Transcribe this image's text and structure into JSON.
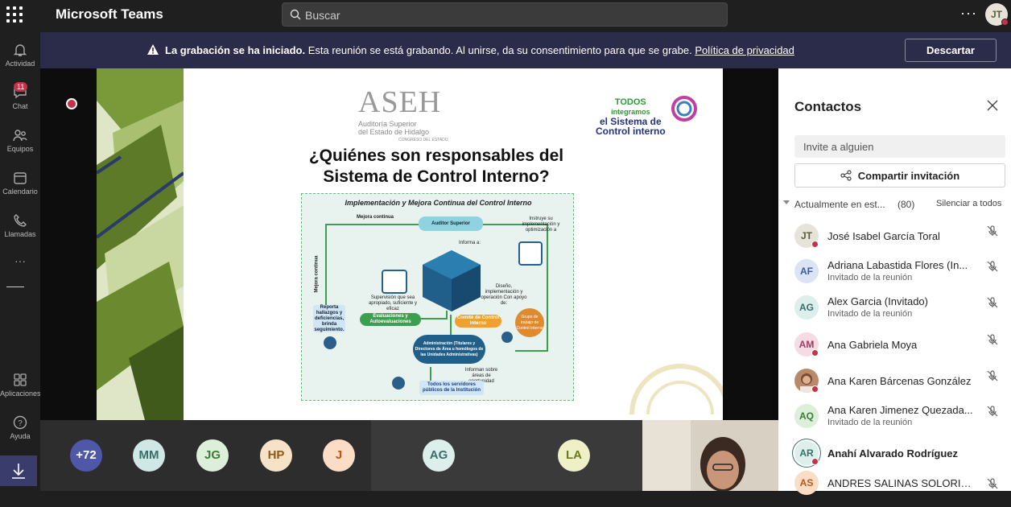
{
  "app": {
    "title": "Microsoft Teams",
    "search_placeholder": "Buscar",
    "more": "···",
    "me_initials": "JT"
  },
  "rail": [
    {
      "label": "Actividad",
      "icon": "bell-icon"
    },
    {
      "label": "Chat",
      "icon": "chat-icon",
      "badge": "11"
    },
    {
      "label": "Equipos",
      "icon": "teams-icon"
    },
    {
      "label": "Calendario",
      "icon": "calendar-icon"
    },
    {
      "label": "Llamadas",
      "icon": "phone-icon"
    },
    {
      "label": "Aplicaciones",
      "icon": "apps-icon"
    },
    {
      "label": "Ayuda",
      "icon": "help-icon"
    }
  ],
  "banner": {
    "bold": "La grabación se ha iniciado.",
    "text": " Esta reunión se está grabando. Al unirse, da su consentimiento para que se grabe. ",
    "link": "Política de privacidad",
    "dismiss": "Descartar"
  },
  "slide": {
    "logo_text": "ASEH",
    "logo_sub1": "Auditoría Superior",
    "logo_sub2": "del Estado de Hidalgo",
    "logo_sub3": "CONGRESO DEL ESTADO",
    "todos_1": "TODOS",
    "todos_2": "integramos",
    "todos_3": "el Sistema de",
    "todos_4": "Control interno",
    "title": "¿Quiénes son responsables del Sistema de Control Interno?",
    "diagram": {
      "title": "Implementación y Mejora Continua del Control Interno",
      "mejora": "Mejora continua",
      "mejora_v": "Mejora continua",
      "auditor": "Auditor Superior",
      "instruye": "Instruye su implementación y optimización a",
      "informa": "Informa a:",
      "supervision": "Supervisión que sea apropiado, suficiente y eficaz",
      "diseno": "Diseño, implementación y operación Con apoyo de:",
      "reporta": "Reporta hallazgos y deficiencias, brinda seguimiento.",
      "evaluaciones": "Evaluaciones y Autoevaluaciones",
      "comite": "Comité de Control Interno",
      "grupo": "Grupo de trabajo de Control Interno",
      "administracion": "Administración (Titulares y Directores de Área u homólogos de las Unidades Administrativas)",
      "informan": "Informan sobre áreas de oportunidad",
      "todos": "Todos los servidores públicos de la Institución"
    }
  },
  "participants_strip": [
    {
      "initials": "+72",
      "bg": "#4e57a8",
      "fg": "#ffffff"
    },
    {
      "initials": "MM",
      "bg": "#cfe8e6",
      "fg": "#3a6e6a"
    },
    {
      "initials": "JG",
      "bg": "#dcefd8",
      "fg": "#3f7a3b"
    },
    {
      "initials": "HP",
      "bg": "#f6e3c7",
      "fg": "#8a5a1a"
    },
    {
      "initials": "J",
      "bg": "#fbdcc4",
      "fg": "#b8581b"
    },
    {
      "initials": "AG",
      "bg": "#dcefea",
      "fg": "#3a6e6a"
    },
    {
      "initials": "LA",
      "bg": "#eef1c7",
      "fg": "#6b7a1d"
    }
  ],
  "panel": {
    "title": "Contactos",
    "invite_placeholder": "Invite a alguien",
    "share": "Compartir invitación",
    "section_name": "Actualmente en est...",
    "section_count": "(80)",
    "mute_all": "Silenciar a todos",
    "people": [
      {
        "initials": "JT",
        "name": "José Isabel García Toral",
        "sub": "",
        "bg": "#e6e4d9",
        "fg": "#5a5a3a",
        "dot": true
      },
      {
        "initials": "AF",
        "name": "Adriana Labastida Flores (In...",
        "sub": "Invitado de la reunión",
        "bg": "#dbe4f4",
        "fg": "#3b5aa0",
        "dot": false
      },
      {
        "initials": "AG",
        "name": "Alex Garcia (Invitado)",
        "sub": "Invitado de la reunión",
        "bg": "#dcefea",
        "fg": "#3a6e6a",
        "dot": false
      },
      {
        "initials": "AM",
        "name": "Ana Gabriela Moya",
        "sub": "",
        "bg": "#f4dbe4",
        "fg": "#a03b63",
        "dot": true
      },
      {
        "initials": "",
        "name": "Ana Karen Bárcenas González",
        "sub": "",
        "bg": "#b98a6a",
        "fg": "#ffffff",
        "dot": true
      },
      {
        "initials": "AQ",
        "name": "Ana Karen Jimenez Quezada...",
        "sub": "Invitado de la reunión",
        "bg": "#dcefd8",
        "fg": "#3f7a3b",
        "dot": false
      },
      {
        "initials": "AR",
        "name": "Anahí Alvarado Rodríguez",
        "sub": "",
        "bg": "#dcefea",
        "fg": "#3a6e6a",
        "dot": true
      },
      {
        "initials": "AS",
        "name": "ANDRES SALINAS SOLORIO ...",
        "sub": "",
        "bg": "#fbdcc4",
        "fg": "#b8581b",
        "dot": true
      }
    ]
  }
}
